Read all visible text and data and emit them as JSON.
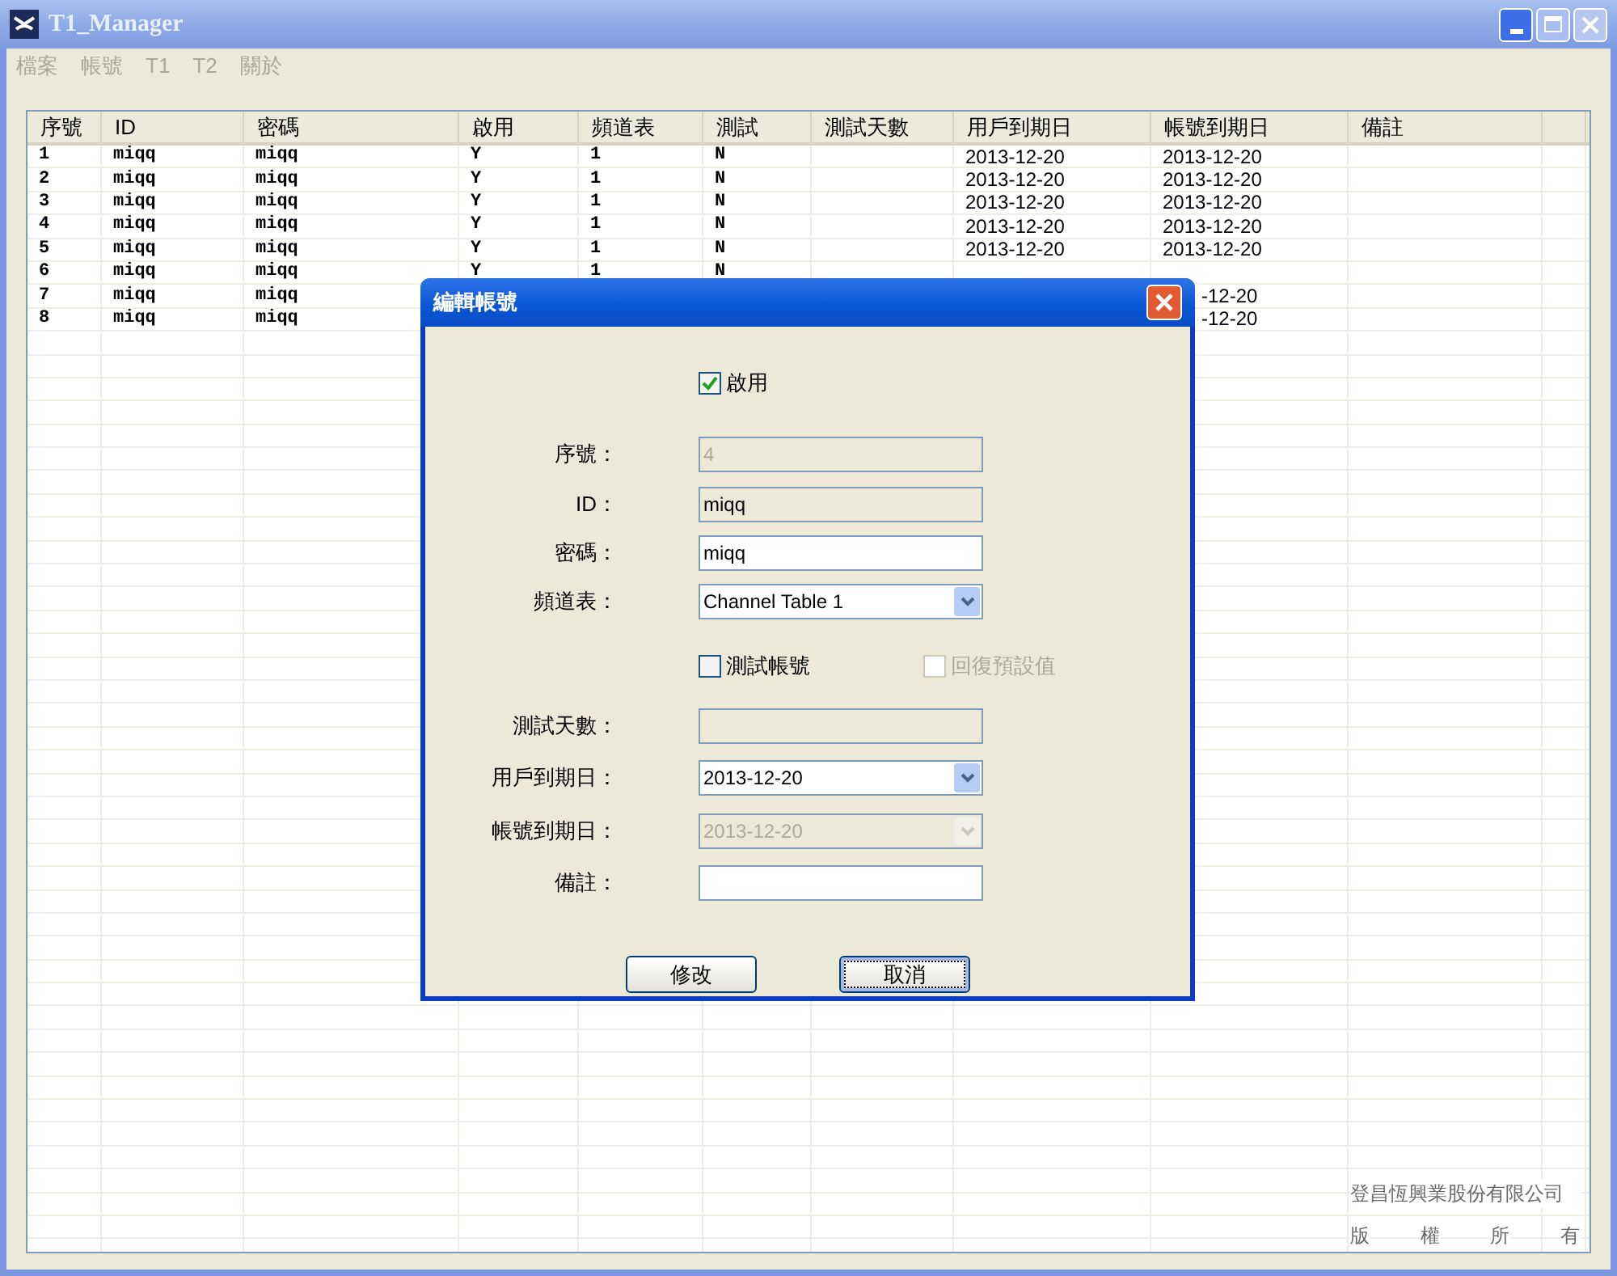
{
  "window": {
    "title": "T1_Manager"
  },
  "menu": [
    {
      "label": "檔案",
      "disabled": true
    },
    {
      "label": "帳號",
      "disabled": true
    },
    {
      "label": "T1",
      "disabled": true
    },
    {
      "label": "T2",
      "disabled": true
    },
    {
      "label": "關於",
      "disabled": true
    }
  ],
  "table": {
    "columns": [
      "序號",
      "ID",
      "密碼",
      "啟用",
      "頻道表",
      "測試",
      "測試天數",
      "用戶到期日",
      "帳號到期日",
      "備註"
    ],
    "rows": [
      [
        "1",
        "miqq",
        "miqq",
        "Y",
        "1",
        "N",
        null,
        "2013-12-20",
        "2013-12-20",
        null
      ],
      [
        "2",
        "miqq",
        "miqq",
        "Y",
        "1",
        "N",
        null,
        "2013-12-20",
        "2013-12-20",
        null
      ],
      [
        "3",
        "miqq",
        "miqq",
        "Y",
        "1",
        "N",
        null,
        "2013-12-20",
        "2013-12-20",
        null
      ],
      [
        "4",
        "miqq",
        "miqq",
        "Y",
        "1",
        "N",
        null,
        "2013-12-20",
        "2013-12-20",
        null
      ],
      [
        "5",
        "miqq",
        "miqq",
        "Y",
        "1",
        "N",
        null,
        "2013-12-20",
        "2013-12-20",
        null
      ],
      [
        "6",
        "miqq",
        "miqq",
        "Y",
        "1",
        "N",
        null,
        null,
        null,
        null
      ],
      [
        "7",
        "miqq",
        "miqq",
        null,
        null,
        null,
        null,
        null,
        "-12-20",
        null
      ],
      [
        "8",
        "miqq",
        "miqq",
        null,
        null,
        null,
        null,
        null,
        "-12-20",
        null
      ]
    ]
  },
  "footer": {
    "company": "登昌恆興業股份有限公司",
    "rights": [
      "版",
      "權",
      "所",
      "有"
    ]
  },
  "dialog": {
    "title": "編輯帳號",
    "rows": [
      {
        "kind": "checkbox",
        "label": "啟用",
        "checked": true,
        "disabled": false
      },
      {
        "kind": "text",
        "label": "序號：",
        "value": "4",
        "disabled": true
      },
      {
        "kind": "text",
        "label": "ID：",
        "value": "miqq",
        "disabled": false,
        "readonly": true
      },
      {
        "kind": "text",
        "label": "密碼：",
        "value": "miqq",
        "disabled": false,
        "readonly": false
      },
      {
        "kind": "select",
        "label": "頻道表：",
        "value": "Channel Table 1",
        "disabled": false,
        "readonly": false
      },
      {
        "kind": "checkpair",
        "label": "測試帳號",
        "checked": false,
        "disabled": false,
        "other": {
          "label": "回復預設值",
          "checked": false,
          "disabled": true
        }
      },
      {
        "kind": "text",
        "label": "測試天數：",
        "disabled": true
      },
      {
        "kind": "select",
        "label": "用戶到期日：",
        "value": "2013-12-20",
        "disabled": false,
        "readonly": false
      },
      {
        "kind": "select",
        "label": "帳號到期日：",
        "value": "2013-12-20",
        "disabled": true
      },
      {
        "kind": "text",
        "label": "備註：",
        "disabled": false,
        "readonly": false
      }
    ],
    "buttons": [
      {
        "label": "修改",
        "focused": false
      },
      {
        "label": "取消",
        "focused": true
      }
    ]
  }
}
